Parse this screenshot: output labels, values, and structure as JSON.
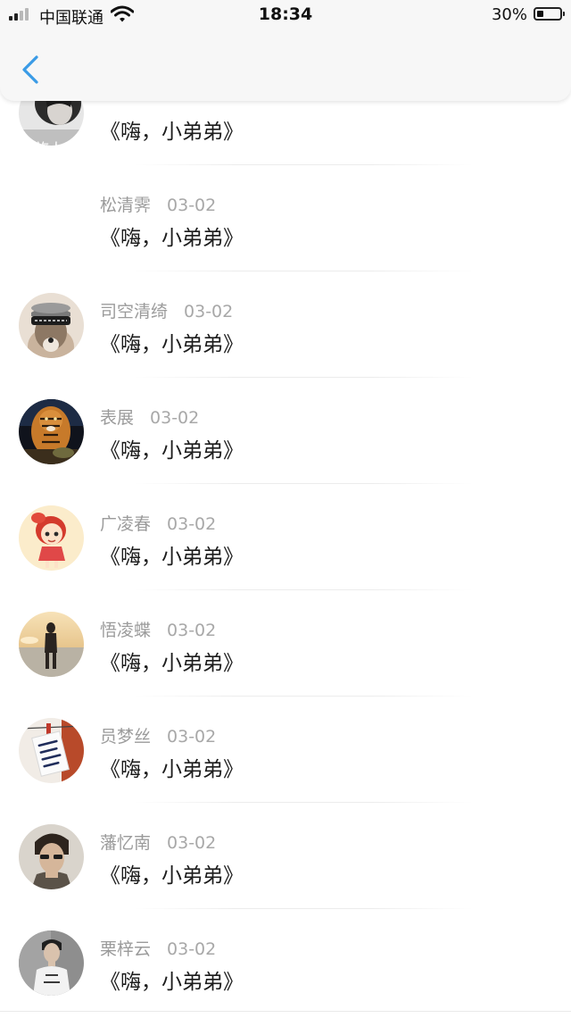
{
  "status_bar": {
    "carrier": "中国联通",
    "time": "18:34",
    "battery_percent_label": "30%",
    "battery_level": 0.3,
    "signal_bars_active": 2,
    "signal_bars_total": 4
  },
  "nav": {
    "back_icon": "chevron-left-icon",
    "accent_color": "#3a9be6"
  },
  "comments": [
    {
      "name": "",
      "date": "",
      "text": "《嗨，小弟弟》",
      "avatar": "traveler"
    },
    {
      "name": "松清霁",
      "date": "03-02",
      "text": "《嗨，小弟弟》",
      "avatar": "none"
    },
    {
      "name": "司空清绮",
      "date": "03-02",
      "text": "《嗨，小弟弟》",
      "avatar": "dog"
    },
    {
      "name": "表展",
      "date": "03-02",
      "text": "《嗨，小弟弟》",
      "avatar": "tiger"
    },
    {
      "name": "广凌春",
      "date": "03-02",
      "text": "《嗨，小弟弟》",
      "avatar": "cartoon-girl"
    },
    {
      "name": "悟凌蝶",
      "date": "03-02",
      "text": "《嗨，小弟弟》",
      "avatar": "sunset-person"
    },
    {
      "name": "员梦丝",
      "date": "03-02",
      "text": "《嗨，小弟弟》",
      "avatar": "love-note"
    },
    {
      "name": "藩忆南",
      "date": "03-02",
      "text": "《嗨，小弟弟》",
      "avatar": "man-portrait"
    },
    {
      "name": "栗梓云",
      "date": "03-02",
      "text": "《嗨，小弟弟》",
      "avatar": "man-grey"
    }
  ],
  "avatar_overlay_text": {
    "traveler": "旅人"
  }
}
